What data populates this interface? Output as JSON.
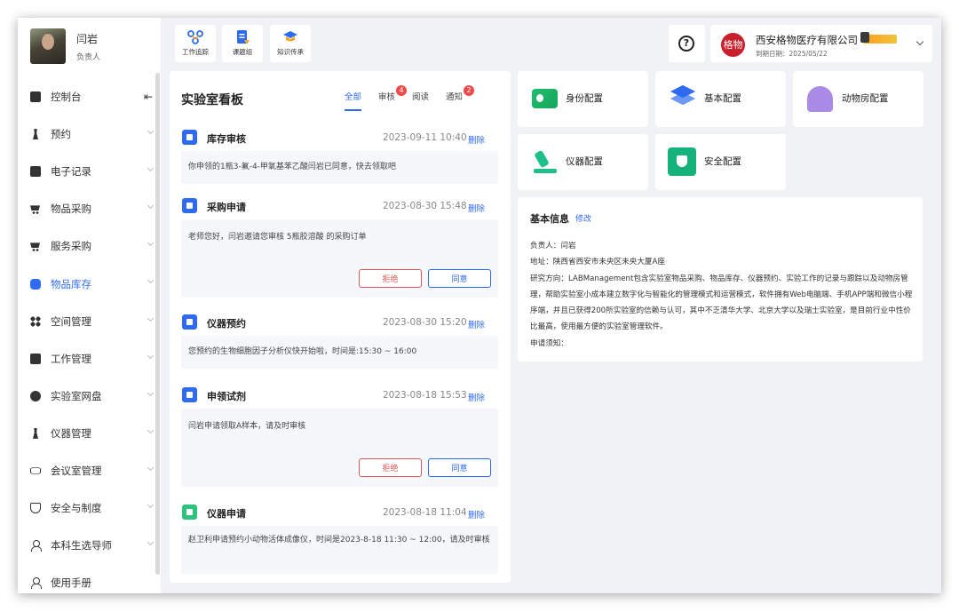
{
  "user": {
    "name": "闫岩",
    "role": "负责人"
  },
  "sidebar": {
    "items": [
      {
        "label": "控制台",
        "icon": "dashboard-icon"
      },
      {
        "label": "预约",
        "icon": "flask-icon"
      },
      {
        "label": "电子记录",
        "icon": "notebook-icon"
      },
      {
        "label": "物品采购",
        "icon": "cart-icon"
      },
      {
        "label": "服务采购",
        "icon": "cart-icon"
      },
      {
        "label": "物品库存",
        "icon": "inventory-icon"
      },
      {
        "label": "空间管理",
        "icon": "grid-icon"
      },
      {
        "label": "工作管理",
        "icon": "work-icon"
      },
      {
        "label": "实验室网盘",
        "icon": "cloud-icon"
      },
      {
        "label": "仪器管理",
        "icon": "microscope-icon"
      },
      {
        "label": "会议室管理",
        "icon": "link-icon"
      },
      {
        "label": "安全与制度",
        "icon": "shield-icon"
      },
      {
        "label": "本科生选导师",
        "icon": "person-icon"
      },
      {
        "label": "使用手册",
        "icon": "person-icon"
      }
    ],
    "collapse_glyph": "⇤"
  },
  "toolbar": {
    "buttons": [
      {
        "label": "工作追踪",
        "icon": "workflow-icon"
      },
      {
        "label": "课题组",
        "icon": "document-icon"
      },
      {
        "label": "知识传承",
        "icon": "graduation-cap-icon"
      }
    ],
    "help_glyph": "?"
  },
  "org": {
    "logo_text": "格物",
    "name": "西安格物医疗有限公司",
    "expiry": "到期日期：2025/05/22"
  },
  "board": {
    "title": "实验室看板",
    "tabs": [
      {
        "label": "全部"
      },
      {
        "label": "审核",
        "badge": "4"
      },
      {
        "label": "阅读"
      },
      {
        "label": "通知",
        "badge": "2"
      }
    ],
    "delete_label": "删除",
    "reject_label": "拒绝",
    "agree_label": "同意",
    "notices": [
      {
        "title": "库存审核",
        "time": "2023-09-11 10:40",
        "body": "你申领的1瓶3-氟-4-甲氧基苯乙酸闫岩已同意，快去领取吧"
      },
      {
        "title": "采购申请",
        "time": "2023-08-30 15:48",
        "body": "老师您好，闫岩邀请您审核 5瓶胶溶酸 的采购订单"
      },
      {
        "title": "仪器预约",
        "time": "2023-08-30 15:20",
        "body": "您预约的生物细胞因子分析仪快开始啦，时间是:15:30 ~ 16:00"
      },
      {
        "title": "申领试剂",
        "time": "2023-08-18 15:53",
        "body": "闫岩申请领取A样本，请及时审核"
      },
      {
        "title": "仪器申请",
        "time": "2023-08-18 11:04",
        "body": "赵卫利申请预约小动物活体成像仪，时间是2023-8-18 11:30 ~ 12:00，请及时审核"
      }
    ]
  },
  "configs": [
    {
      "label": "身份配置",
      "icon": "id-card-icon"
    },
    {
      "label": "基本配置",
      "icon": "layers-icon"
    },
    {
      "label": "动物房配置",
      "icon": "animal-house-icon"
    },
    {
      "label": "仪器配置",
      "icon": "microscope-icon"
    },
    {
      "label": "安全配置",
      "icon": "shield-check-icon"
    }
  ],
  "info": {
    "title": "基本信息",
    "edit_label": "修改",
    "owner": "负责人：闫岩",
    "address": "地址：陕西省西安市未央区未央大厦A座",
    "research": "研究方向：LABManagement包含实验室物品采购、物品库存、仪器预约、实验工作的记录与跟踪以及动物房管理，帮助实验室小成本建立数字化与智能化的管理模式和运营模式，软件拥有Web电脑端、手机APP端和微信小程序端，并且已获得200所实验室的信赖与认可，其中不乏清华大学、北京大学以及瑞士实验室，是目前行业中性价比最高，使用最方便的实验室管理软件。",
    "notice": "申请须知："
  },
  "colors": {
    "primary": "#2f6bf0",
    "danger": "#e05757",
    "badge": "#ef4a4a",
    "background": "#f0f2f5"
  }
}
